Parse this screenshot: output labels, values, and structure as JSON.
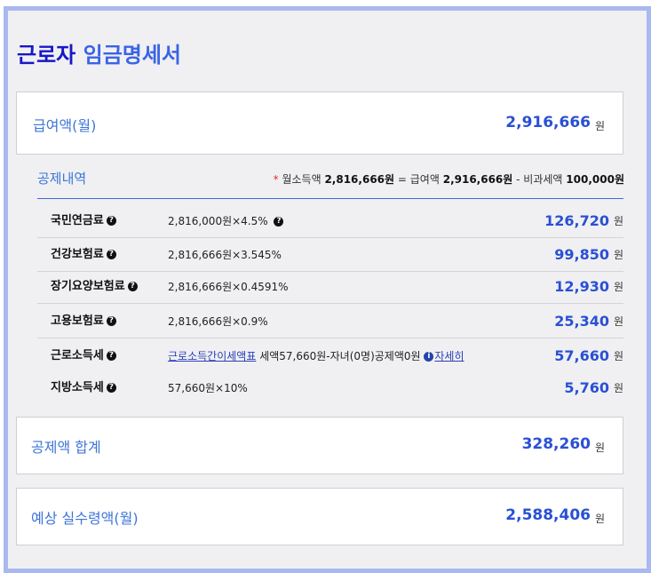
{
  "title": {
    "dark": "근로자",
    "light": "임금명세서"
  },
  "salary": {
    "label": "급여액(월)",
    "value": "2,916,666",
    "unit": "원"
  },
  "deductions": {
    "heading": "공제내역",
    "formula": {
      "star": "*",
      "prefix": "월소득액",
      "income": "2,816,666원",
      "eq": "= 급여액",
      "salary": "2,916,666원",
      "minus": "- 비과세액",
      "nontax": "100,000원"
    },
    "rows": [
      {
        "name": "국민연금료",
        "calc": "2,816,000원×4.5%",
        "calc_help": true,
        "amount": "126,720",
        "unit": "원"
      },
      {
        "name": "건강보험료",
        "calc": "2,816,666원×3.545%",
        "amount": "99,850",
        "unit": "원"
      },
      {
        "name": "장기요양보험료",
        "calc": "2,816,666원×0.4591%",
        "amount": "12,930",
        "unit": "원"
      },
      {
        "name": "고용보험료",
        "calc": "2,816,666원×0.9%",
        "amount": "25,340",
        "unit": "원"
      },
      {
        "name": "근로소득세",
        "calc_link": "근로소득간이세액표",
        "calc_rest": "세액57,660원-자녀(0명)공제액0원",
        "calc_detail": "자세히",
        "amount": "57,660",
        "unit": "원"
      },
      {
        "name": "지방소득세",
        "calc": "57,660원×10%",
        "amount": "5,760",
        "unit": "원"
      }
    ]
  },
  "total": {
    "label": "공제액 합계",
    "value": "328,260",
    "unit": "원"
  },
  "net": {
    "label": "예상 실수령액(월)",
    "value": "2,588,406",
    "unit": "원"
  }
}
